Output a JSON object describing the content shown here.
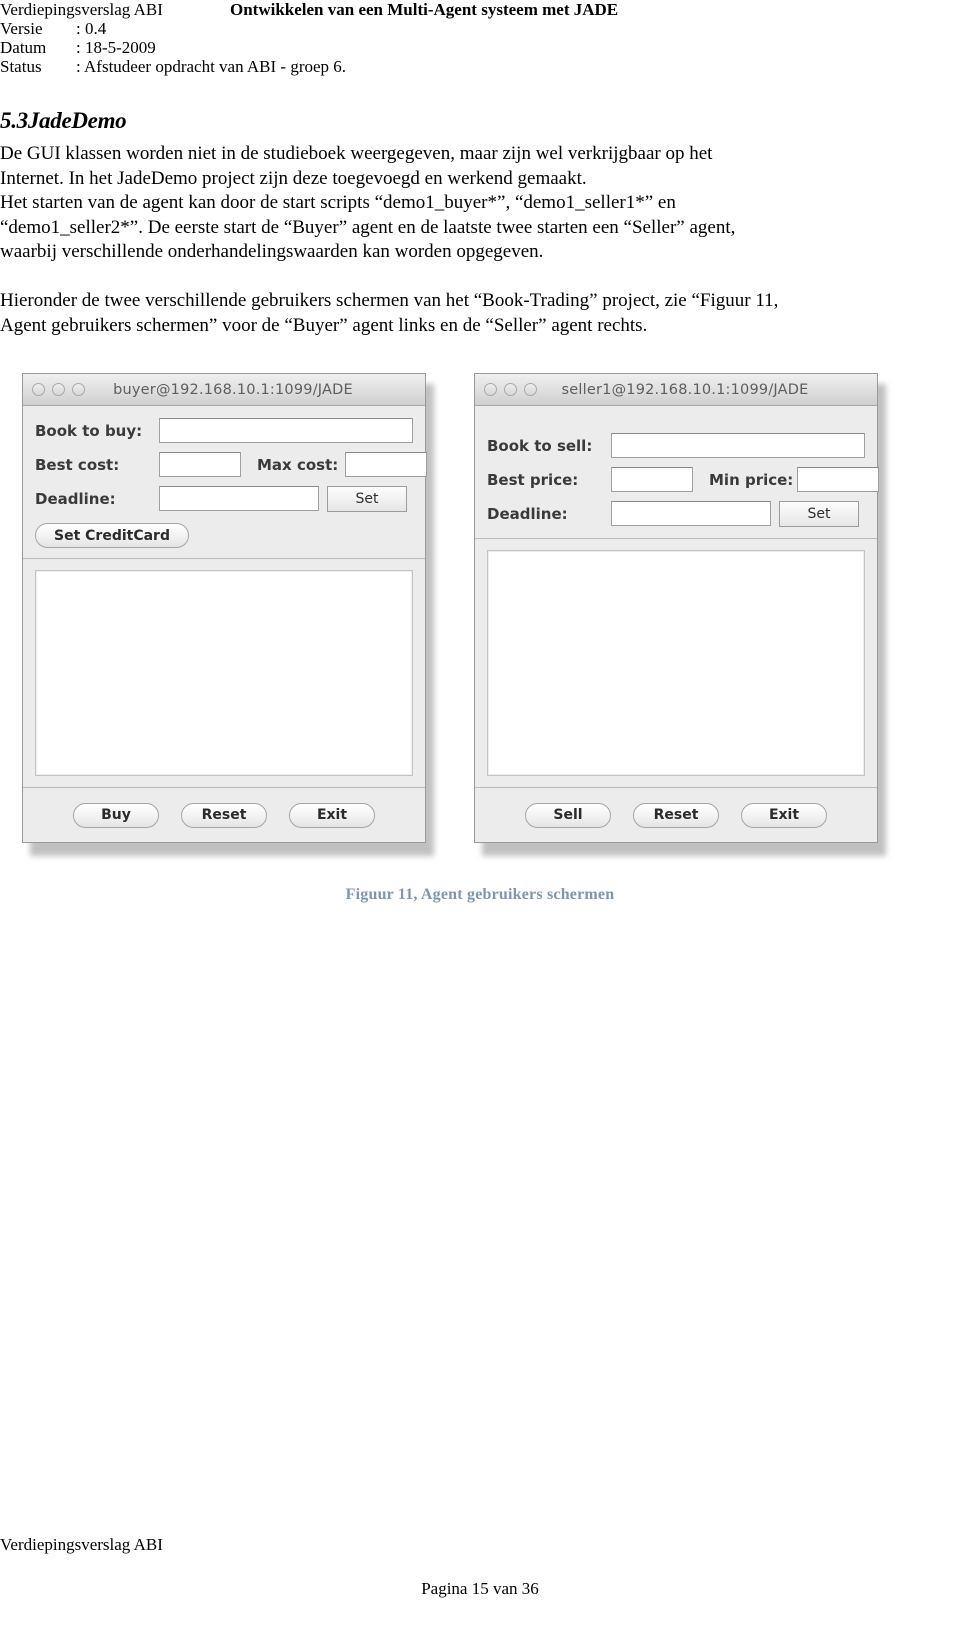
{
  "header": {
    "doc_title": "Verdiepingsverslag ABI",
    "main_title": "Ontwikkelen van een Multi-Agent systeem met JADE",
    "rows": [
      {
        "label": "Versie",
        "value": ": 0.4"
      },
      {
        "label": "Datum",
        "value": ": 18-5-2009"
      },
      {
        "label": "Status",
        "value": ": Afstudeer opdracht van ABI - groep 6."
      }
    ]
  },
  "section": {
    "heading": "5.3JadeDemo",
    "paragraph_1_line_1": "De GUI klassen worden niet in de studieboek weergegeven, maar zijn wel verkrijgbaar op het",
    "paragraph_1_line_2": "Internet. In het JadeDemo project zijn deze toegevoegd en werkend gemaakt.",
    "paragraph_1_line_3": "Het starten van de agent kan door de start scripts “demo1_buyer*”, “demo1_seller1*” en",
    "paragraph_1_line_4": "“demo1_seller2*”. De eerste start de “Buyer” agent en de laatste twee starten een “Seller” agent,",
    "paragraph_1_line_5": "waarbij verschillende onderhandelingswaarden kan worden opgegeven.",
    "paragraph_2_line_1": "Hieronder de twee verschillende gebruikers schermen van het “Book-Trading” project, zie “Figuur 11,",
    "paragraph_2_line_2": "Agent gebruikers schermen” voor de “Buyer” agent links en de “Seller” agent rechts."
  },
  "figure": {
    "caption": "Figuur 11,  Agent gebruikers schermen",
    "caption_color": "#7f96b0",
    "buyer_window": {
      "title": "buyer@192.168.10.1:1099/JADE",
      "traffic_lights": [
        "close-button",
        "minimize-button",
        "zoom-button"
      ],
      "fields": [
        {
          "label": "Book to buy:",
          "value": "",
          "placeholder": ""
        },
        {
          "label": "Best cost:",
          "value": "",
          "placeholder": ""
        },
        {
          "label": "Max cost:",
          "value": "",
          "placeholder": ""
        },
        {
          "label": "Deadline:",
          "value": "",
          "placeholder": ""
        }
      ],
      "set_button": "Set",
      "creditcard_button": "Set CreditCard",
      "log_value": "",
      "actions": [
        "Buy",
        "Reset",
        "Exit"
      ]
    },
    "seller_window": {
      "title": "seller1@192.168.10.1:1099/JADE",
      "traffic_lights": [
        "close-button",
        "minimize-button",
        "zoom-button"
      ],
      "fields": [
        {
          "label": "Book to sell:",
          "value": "",
          "placeholder": ""
        },
        {
          "label": "Best price:",
          "value": "",
          "placeholder": ""
        },
        {
          "label": "Min price:",
          "value": "",
          "placeholder": ""
        },
        {
          "label": "Deadline:",
          "value": "",
          "placeholder": ""
        }
      ],
      "set_button": "Set",
      "log_value": "",
      "actions": [
        "Sell",
        "Reset",
        "Exit"
      ]
    }
  },
  "footer": {
    "left": "Verdiepingsverslag ABI",
    "page": "Pagina 15 van 36"
  }
}
